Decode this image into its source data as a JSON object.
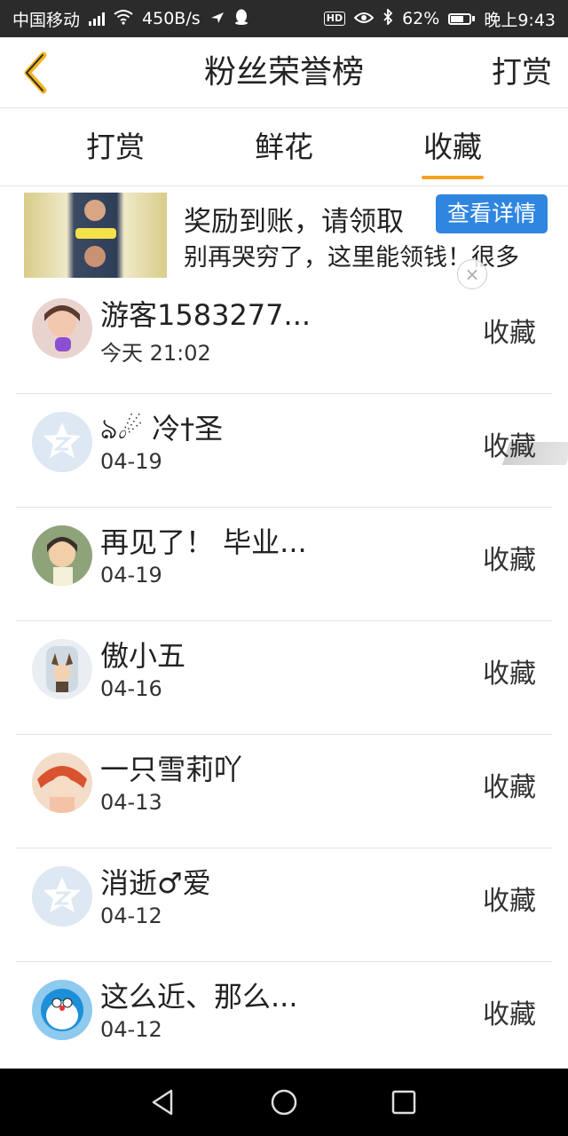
{
  "status_bar": {
    "carrier": "中国移动",
    "network": "4G",
    "speed": "450B/s",
    "battery_percent": "62%",
    "battery_level": 0.62,
    "time": "晚上9:43",
    "hd_label": "HD"
  },
  "header": {
    "title": "粉丝荣誉榜",
    "action_label": "打赏"
  },
  "tabs": [
    {
      "label": "打赏"
    },
    {
      "label": "鲜花"
    },
    {
      "label": "收藏"
    }
  ],
  "active_tab": "收藏",
  "ad": {
    "headline": "奖励到账，请领取",
    "cta_label": "查看详情",
    "subtext": "别再哭穷了，这里能领钱！很多",
    "close_symbol": "×"
  },
  "entries": [
    {
      "name": "游客1583277...",
      "time": "今天 21:02",
      "type": "收藏"
    },
    {
      "name": "ঌ☄ 冷†圣",
      "time": "04-19",
      "type": "收藏"
    },
    {
      "name": "再见了！ 毕业...",
      "time": "04-19",
      "type": "收藏"
    },
    {
      "name": "傲小五",
      "time": "04-16",
      "type": "收藏"
    },
    {
      "name": "一只雪莉吖",
      "time": "04-13",
      "type": "收藏"
    },
    {
      "name": "消逝♂爱",
      "time": "04-12",
      "type": "收藏"
    },
    {
      "name": "这么近、那么...",
      "time": "04-12",
      "type": "收藏"
    }
  ],
  "colors": {
    "accent": "#f5a21b",
    "cta_blue": "#2f86e0",
    "status_bg": "#2b2b2b",
    "nav_bg": "#000000"
  },
  "icons": {
    "back": "chevron-left-icon",
    "system_back": "triangle-back-icon",
    "system_home": "circle-home-icon",
    "system_recent": "square-recent-icon"
  }
}
